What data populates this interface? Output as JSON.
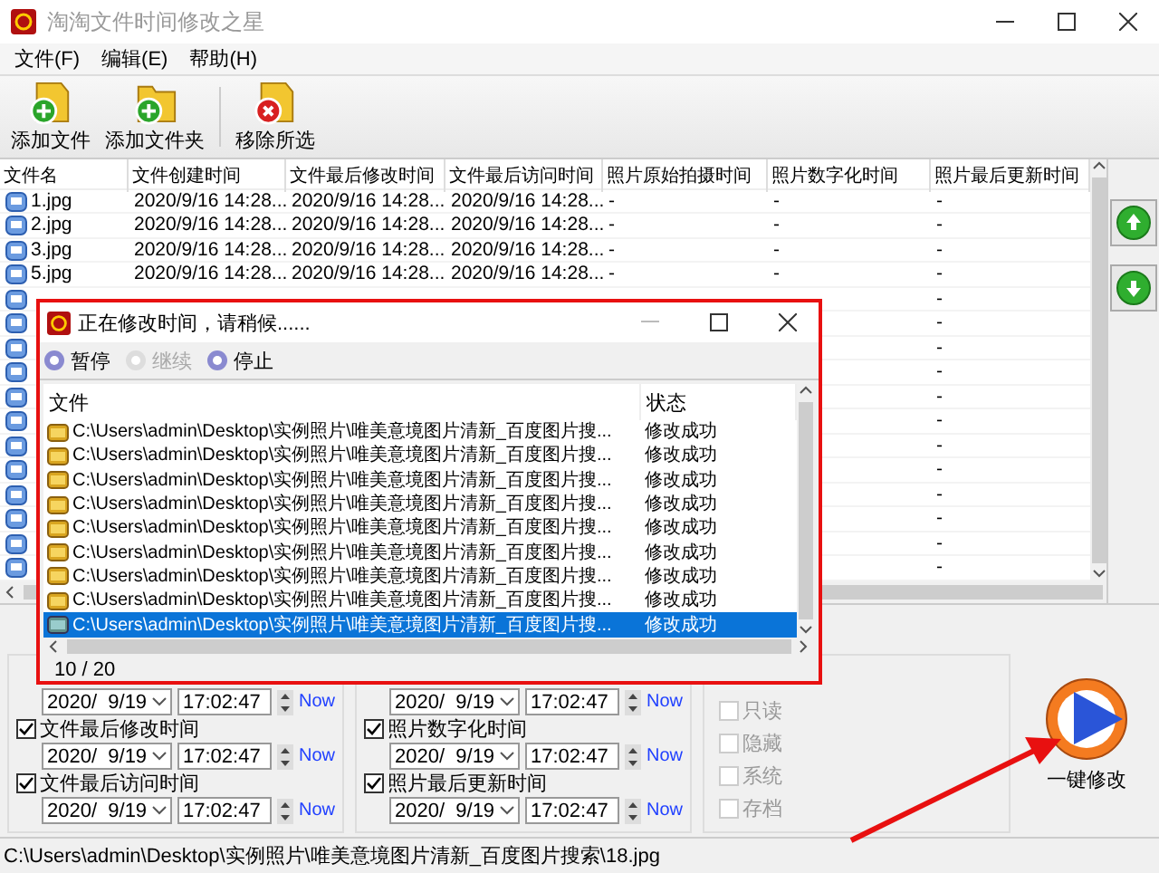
{
  "window": {
    "title": "淘淘文件时间修改之星"
  },
  "menu": [
    "文件(F)",
    "编辑(E)",
    "帮助(H)"
  ],
  "toolbar": [
    {
      "label": "添加文件",
      "kind": "add-file"
    },
    {
      "label": "添加文件夹",
      "kind": "add-folder"
    },
    {
      "label": "移除所选",
      "kind": "remove"
    }
  ],
  "file_table": {
    "columns": [
      "文件名",
      "文件创建时间",
      "文件最后修改时间",
      "文件最后访问时间",
      "照片原始拍摄时间",
      "照片数字化时间",
      "照片最后更新时间"
    ],
    "rows": [
      {
        "name": "1.jpg",
        "created": "2020/9/16 14:28...",
        "modified": "2020/9/16 14:28...",
        "accessed": "2020/9/16 14:28...",
        "original": "-",
        "digitized": "-",
        "updated": "-"
      },
      {
        "name": "2.jpg",
        "created": "2020/9/16 14:28...",
        "modified": "2020/9/16 14:28...",
        "accessed": "2020/9/16 14:28...",
        "original": "-",
        "digitized": "-",
        "updated": "-"
      },
      {
        "name": "3.jpg",
        "created": "2020/9/16 14:28...",
        "modified": "2020/9/16 14:28...",
        "accessed": "2020/9/16 14:28...",
        "original": "-",
        "digitized": "-",
        "updated": "-"
      },
      {
        "name": "5.jpg",
        "created": "2020/9/16 14:28...",
        "modified": "2020/9/16 14:28...",
        "accessed": "2020/9/16 14:28...",
        "original": "-",
        "digitized": "-",
        "updated": "-"
      },
      {
        "updated": "-"
      },
      {
        "updated": "-"
      },
      {
        "updated": "-"
      },
      {
        "updated": "-"
      },
      {
        "updated": "-"
      },
      {
        "updated": "-"
      },
      {
        "updated": "-"
      },
      {
        "updated": "-"
      },
      {
        "updated": "-"
      },
      {
        "updated": "-"
      },
      {
        "updated": "-"
      },
      {
        "updated": "-"
      }
    ]
  },
  "time_settings": [
    {
      "items": [
        {
          "date": "2020/  9/19",
          "time": "17:02:47",
          "now": "Now"
        },
        {
          "label": "文件最后修改时间",
          "checked": true,
          "date": "2020/  9/19",
          "time": "17:02:47",
          "now": "Now"
        },
        {
          "label": "文件最后访问时间",
          "checked": true,
          "date": "2020/  9/19",
          "time": "17:02:47",
          "now": "Now"
        }
      ]
    },
    {
      "items": [
        {
          "date": "2020/  9/19",
          "time": "17:02:47",
          "now": "Now"
        },
        {
          "label": "照片数字化时间",
          "checked": true,
          "date": "2020/  9/19",
          "time": "17:02:47",
          "now": "Now"
        },
        {
          "label": "照片最后更新时间",
          "checked": true,
          "date": "2020/  9/19",
          "time": "17:02:47",
          "now": "Now"
        }
      ]
    }
  ],
  "attributes": [
    {
      "label": "只读",
      "checked": false
    },
    {
      "label": "隐藏",
      "checked": false
    },
    {
      "label": "系统",
      "checked": false
    },
    {
      "label": "存档",
      "checked": false
    }
  ],
  "run_button": {
    "label": "一键修改"
  },
  "status_bar": "C:\\Users\\admin\\Desktop\\实例照片\\唯美意境图片清新_百度图片搜索\\18.jpg",
  "dialog": {
    "title": "正在修改时间，请稍候......",
    "actions": [
      {
        "label": "暂停",
        "disabled": false
      },
      {
        "label": "继续",
        "disabled": true
      },
      {
        "label": "停止",
        "disabled": false
      }
    ],
    "columns": [
      "文件",
      "状态"
    ],
    "rows": [
      {
        "file": "C:\\Users\\admin\\Desktop\\实例照片\\唯美意境图片清新_百度图片搜...",
        "status": "修改成功",
        "selected": false
      },
      {
        "file": "C:\\Users\\admin\\Desktop\\实例照片\\唯美意境图片清新_百度图片搜...",
        "status": "修改成功",
        "selected": false
      },
      {
        "file": "C:\\Users\\admin\\Desktop\\实例照片\\唯美意境图片清新_百度图片搜...",
        "status": "修改成功",
        "selected": false
      },
      {
        "file": "C:\\Users\\admin\\Desktop\\实例照片\\唯美意境图片清新_百度图片搜...",
        "status": "修改成功",
        "selected": false
      },
      {
        "file": "C:\\Users\\admin\\Desktop\\实例照片\\唯美意境图片清新_百度图片搜...",
        "status": "修改成功",
        "selected": false
      },
      {
        "file": "C:\\Users\\admin\\Desktop\\实例照片\\唯美意境图片清新_百度图片搜...",
        "status": "修改成功",
        "selected": false
      },
      {
        "file": "C:\\Users\\admin\\Desktop\\实例照片\\唯美意境图片清新_百度图片搜...",
        "status": "修改成功",
        "selected": false
      },
      {
        "file": "C:\\Users\\admin\\Desktop\\实例照片\\唯美意境图片清新_百度图片搜...",
        "status": "修改成功",
        "selected": false
      },
      {
        "file": "C:\\Users\\admin\\Desktop\\实例照片\\唯美意境图片清新_百度图片搜...",
        "status": "修改成功",
        "selected": true
      }
    ],
    "progress": "10 / 20"
  }
}
